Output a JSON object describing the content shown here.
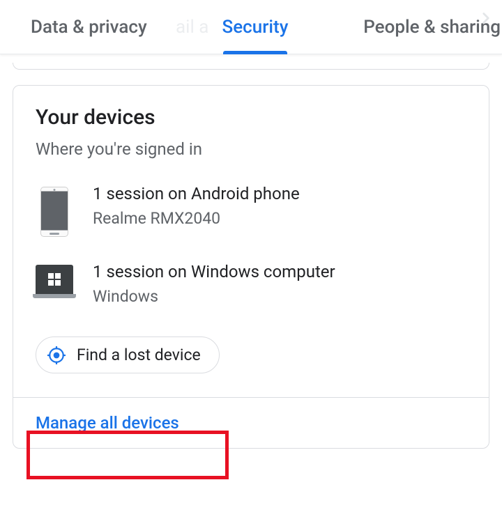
{
  "tabs": {
    "data_privacy": "Data & privacy",
    "security": "Security",
    "people_sharing": "People & sharing",
    "ghost": "ail a"
  },
  "devices_card": {
    "title": "Your devices",
    "subtitle": "Where you're signed in",
    "items": [
      {
        "title": "1 session on Android phone",
        "sub": "Realme RMX2040"
      },
      {
        "title": "1 session on Windows computer",
        "sub": "Windows"
      }
    ],
    "find_lost": "Find a lost device",
    "manage_all": "Manage all devices"
  }
}
